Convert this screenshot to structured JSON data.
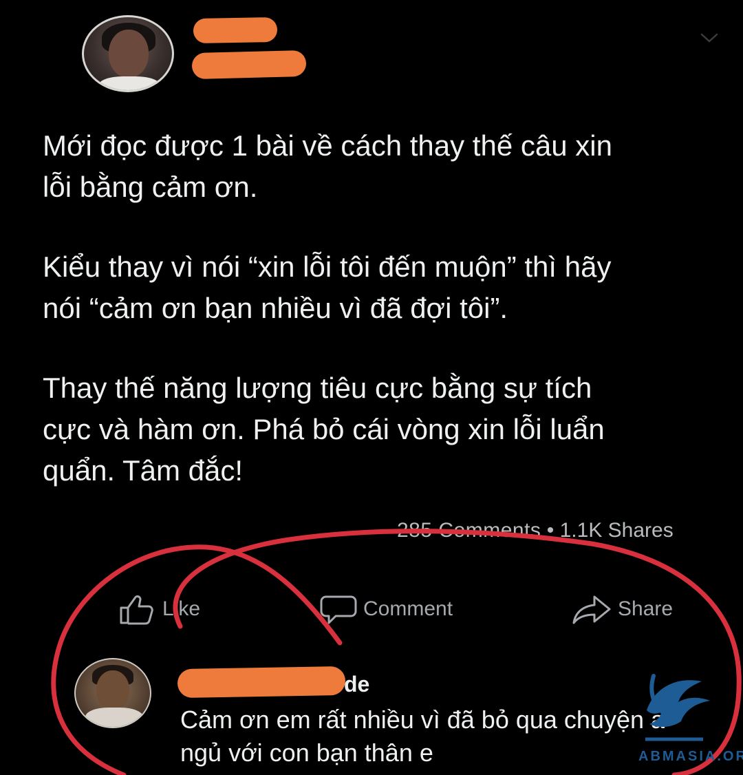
{
  "post": {
    "author_redacted": true,
    "paragraphs": [
      "Mới đọc được 1 bài về cách thay thế câu xin\nlỗi bằng cảm ơn.",
      "Kiểu thay vì nói “xin lỗi tôi đến muộn” thì hãy\nnói “cảm ơn bạn nhiều vì đã đợi tôi”.",
      "Thay thế năng lượng tiêu cực bằng sự tích\ncực và hàm ơn. Phá bỏ cái vòng xin lỗi luẩn\nquẩn. Tâm đắc!"
    ],
    "comments_count_text": "285 Comments",
    "separator": " • ",
    "shares_text": "1.1K Shares"
  },
  "actions": {
    "like_label": "Like",
    "comment_label": "Comment",
    "share_label": "Share"
  },
  "comment": {
    "author_visible_fragment": "de",
    "text": "Cảm ơn em rất nhiều vì đã bỏ qua chuyện a\nngủ với con bạn thân e"
  },
  "watermark": {
    "text": "ABMASIA.ORG"
  },
  "colors": {
    "background": "#000000",
    "redaction": "#ee7b3b",
    "annotation": "#d8303d",
    "watermark": "#1e5c96"
  },
  "icons": [
    "chevron-down-icon",
    "thumbs-up-icon",
    "comment-bubble-icon",
    "share-arrow-icon"
  ]
}
